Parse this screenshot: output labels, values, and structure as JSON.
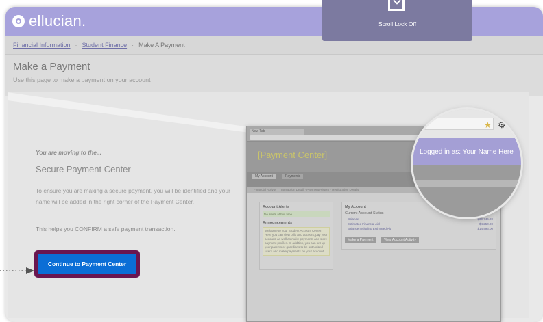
{
  "brand": {
    "name": "ellucian."
  },
  "breadcrumb": {
    "items": [
      "Financial Information",
      "Student Finance",
      "Make A Payment"
    ],
    "separator": "·"
  },
  "header": {
    "title": "Make a Payment",
    "subtitle": "Use this page to make a payment on your account"
  },
  "main": {
    "moving_text": "You are moving to the...",
    "secure_title": "Secure Payment Center",
    "description": "To ensure you are making a secure payment, you will be identified and your name will be added in the right corner of the Payment Center.",
    "confirm_text": "This helps you CONFIRM a safe payment transaction.",
    "continue_label": "Continue to Payment Center"
  },
  "preview": {
    "tab_label": "New Tab",
    "title": "[Payment Center]",
    "nav_tabs": [
      "My Account",
      "Payments"
    ],
    "subnav": "Financial Activity · Transaction Detail · Payment History · Registration Details",
    "left_panel": {
      "heading": "Account Alerts",
      "note": "No alerts at this time",
      "announcements_heading": "Announcements",
      "announcement_body": "Welcome to your Student Account Center! Here you can view bills and account, pay your account, as well as make payments and store payment profiles. In addition, you can set up your parents or guardians to be authorized users and make payments on your account."
    },
    "right_panel": {
      "heading": "My Account",
      "status_heading": "Current Account Status",
      "rows": [
        {
          "label": "Balance",
          "value": "$30,746.00"
        },
        {
          "label": "Estimated Financial Aid",
          "value": "$4,250.00"
        },
        {
          "label": "Balance Including Estimated Aid",
          "value": "$14,496.00"
        }
      ],
      "buttons": [
        "Make a Payment",
        "View Account Activity"
      ]
    }
  },
  "magnifier": {
    "text": "Logged in as: Your Name Here"
  },
  "toast": {
    "text": "Scroll Lock Off"
  },
  "colors": {
    "brand_bar": "#a7a2dc",
    "cta": "#0b6ed6",
    "cta_outline": "#6a1650"
  }
}
